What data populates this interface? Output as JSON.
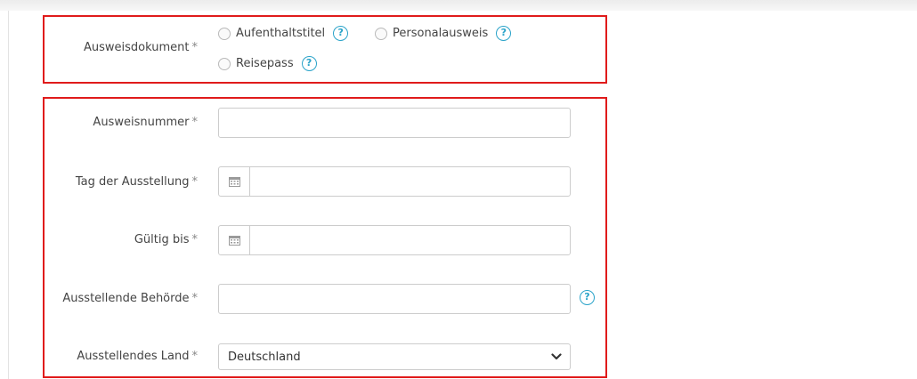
{
  "document_type": {
    "label": "Ausweisdokument",
    "required_marker": "*",
    "options": [
      {
        "label": "Aufenthaltstitel",
        "help": "?"
      },
      {
        "label": "Personalausweis",
        "help": "?"
      },
      {
        "label": "Reisepass",
        "help": "?"
      }
    ]
  },
  "fields": {
    "id_number": {
      "label": "Ausweisnummer",
      "required_marker": "*",
      "value": ""
    },
    "issue_date": {
      "label": "Tag der Ausstellung",
      "required_marker": "*",
      "value": ""
    },
    "valid_until": {
      "label": "Gültig bis",
      "required_marker": "*",
      "value": ""
    },
    "issuing_authority": {
      "label": "Ausstellende Behörde",
      "required_marker": "*",
      "value": "",
      "help": "?"
    },
    "issuing_country": {
      "label": "Ausstellendes Land",
      "required_marker": "*",
      "selected": "Deutschland"
    }
  },
  "colors": {
    "highlight": "#e01b1b",
    "help_accent": "#2aa3c9"
  },
  "icons": {
    "calendar": "calendar-icon",
    "help": "help-circle-icon",
    "chevron": "chevron-down-icon"
  }
}
